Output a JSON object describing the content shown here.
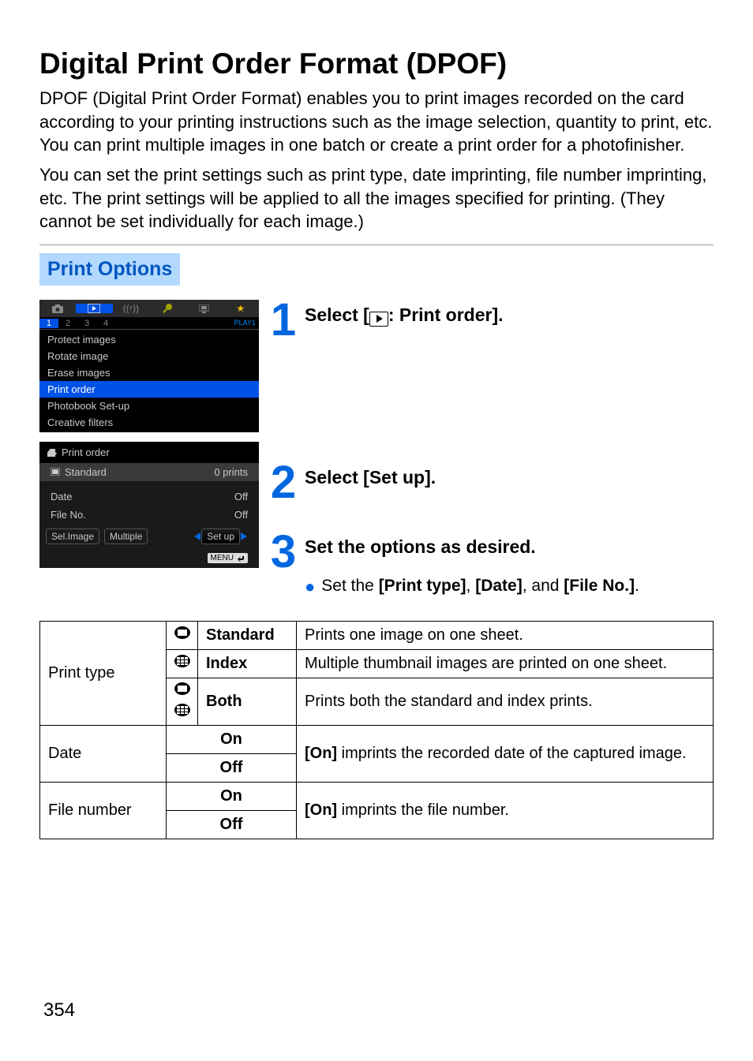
{
  "title": "Digital Print Order Format (DPOF)",
  "intro1": "DPOF (Digital Print Order Format) enables you to print images recorded on the card according to your printing instructions such as the image selection, quantity to print, etc. You can print multiple images in one batch or create a print order for a photofinisher.",
  "intro2": "You can set the print settings such as print type, date imprinting, file number imprinting, etc. The print settings will be applied to all the images specified for printing. (They cannot be set individually for each image.)",
  "section": "Print Options",
  "steps": {
    "s1": {
      "num": "1",
      "text_pre": "Select [",
      "text_post": ": Print order]."
    },
    "s2": {
      "num": "2",
      "text": "Select [Set up]."
    },
    "s3": {
      "num": "3",
      "text": "Set the options as desired.",
      "bullet_pre": "Set the ",
      "b1": "[Print type]",
      "c1": ", ",
      "b2": "[Date]",
      "c2": ", and ",
      "b3": "[File No.]",
      "c3": "."
    }
  },
  "cam1": {
    "subtabs": [
      "1",
      "2",
      "3",
      "4"
    ],
    "playtag": "PLAY1",
    "items": [
      "Protect images",
      "Rotate image",
      "Erase images",
      "Print order",
      "Photobook Set-up",
      "Creative filters"
    ],
    "selected_index": 3
  },
  "cam2": {
    "title": "Print order",
    "row1_l": "Standard",
    "row1_r": "0 prints",
    "row2_l": "Date",
    "row2_r": "Off",
    "row3_l": "File No.",
    "row3_r": "Off",
    "btn1": "Sel.Image",
    "btn2": "Multiple",
    "btn3": "Set up",
    "menuback": "MENU"
  },
  "table": {
    "printtype_label": "Print type",
    "standard": {
      "name": "Standard",
      "desc": "Prints one image on one sheet."
    },
    "index": {
      "name": "Index",
      "desc": "Multiple thumbnail images are printed on one sheet."
    },
    "both": {
      "name": "Both",
      "desc": "Prints both the standard and index prints."
    },
    "date_label": "Date",
    "date_on": "On",
    "date_off": "Off",
    "date_desc_pre": "[On]",
    "date_desc_post": " imprints the recorded date of the captured image.",
    "file_label": "File number",
    "file_on": "On",
    "file_off": "Off",
    "file_desc_pre": "[On]",
    "file_desc_post": " imprints the file number."
  },
  "page": "354"
}
